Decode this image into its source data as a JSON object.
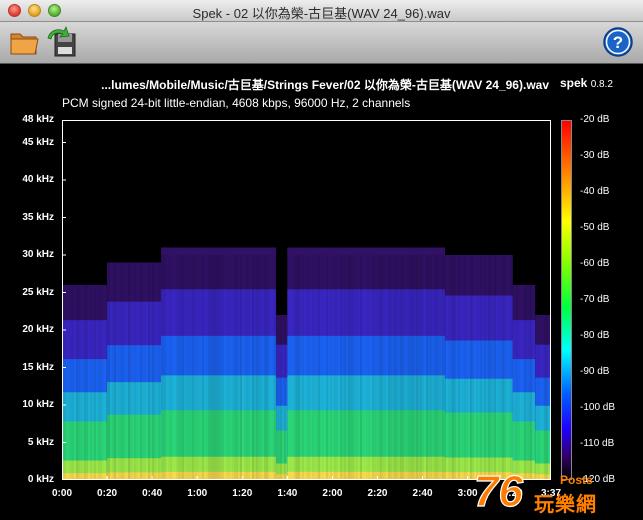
{
  "window": {
    "title": "Spek - 02 以你為榮-古巨基(WAV 24_96).wav"
  },
  "toolbar": {
    "open_icon": "folder-open-icon",
    "save_icon": "save-export-icon",
    "help_icon": "help-icon"
  },
  "header": {
    "file_title": "...lumes/Mobile/Music/古巨基/Strings Fever/02 以你為榮-古巨基(WAV 24_96).wav",
    "brand": "spek",
    "version": "0.8.2",
    "info": "PCM signed 24-bit little-endian, 4608 kbps, 96000 Hz, 2 channels"
  },
  "chart_data": {
    "type": "heatmap",
    "x_ticks": [
      "0:00",
      "0:20",
      "0:40",
      "1:00",
      "1:20",
      "1:40",
      "2:00",
      "2:20",
      "2:40",
      "3:00",
      "3:20",
      "3:37"
    ],
    "y_ticks": [
      "48 kHz",
      "45 kHz",
      "40 kHz",
      "35 kHz",
      "30 kHz",
      "25 kHz",
      "20 kHz",
      "15 kHz",
      "10 kHz",
      "5 kHz",
      "0 kHz"
    ],
    "x_values": [
      0,
      20,
      40,
      60,
      80,
      100,
      120,
      140,
      160,
      180,
      200,
      217
    ],
    "y_values": [
      48,
      45,
      40,
      35,
      30,
      25,
      20,
      15,
      10,
      5,
      0
    ],
    "xlim": [
      0,
      217
    ],
    "ylim": [
      0,
      48
    ],
    "colorbar_labels": [
      "-20 dB",
      "-30 dB",
      "-40 dB",
      "-50 dB",
      "-60 dB",
      "-70 dB",
      "-80 dB",
      "-90 dB",
      "-100 dB",
      "-110 dB",
      "-120 dB"
    ],
    "colorbar_values": [
      -20,
      -30,
      -40,
      -50,
      -60,
      -70,
      -80,
      -90,
      -100,
      -110,
      -120
    ],
    "color_range": [
      -120,
      -20
    ],
    "segments": [
      {
        "start": 0,
        "end": 20,
        "top_khz": 26
      },
      {
        "start": 20,
        "end": 44,
        "top_khz": 29
      },
      {
        "start": 44,
        "end": 95,
        "top_khz": 31
      },
      {
        "start": 95,
        "end": 100,
        "top_khz": 22
      },
      {
        "start": 100,
        "end": 170,
        "top_khz": 31
      },
      {
        "start": 170,
        "end": 200,
        "top_khz": 30
      },
      {
        "start": 200,
        "end": 210,
        "top_khz": 26
      },
      {
        "start": 210,
        "end": 217,
        "top_khz": 22
      }
    ]
  },
  "watermark": {
    "posts": "Posts",
    "cn": "玩樂網",
    "number": "76"
  }
}
